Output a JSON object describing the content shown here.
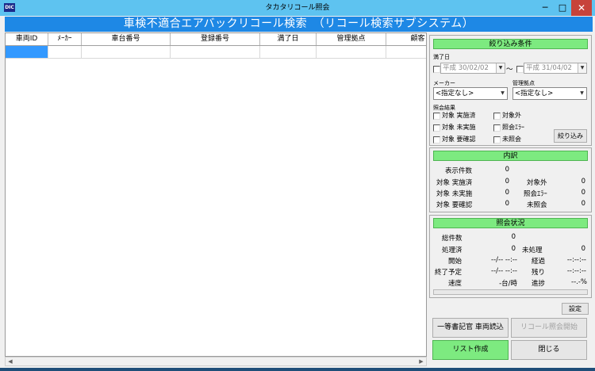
{
  "window": {
    "title": "タカタリコール照会",
    "icon_text": "DIC",
    "minimize": "─",
    "maximize": "□",
    "close": "✕"
  },
  "banner": {
    "title": "車検不適合エアバックリコール検索　（リコール検索サブシステム）"
  },
  "grid": {
    "columns": [
      "車両ID",
      "ﾒｰｶｰ",
      "車台番号",
      "登録番号",
      "満了日",
      "管理拠点",
      "顧客"
    ]
  },
  "scroll": {
    "left": "◀",
    "right": "▶"
  },
  "filter": {
    "header": "絞り込み条件",
    "expiry_label": "満了日",
    "date_from": "平成 30/02/02",
    "date_to": "平成 31/04/02",
    "tilde": "～",
    "maker_label": "メーカー",
    "maker_value": "<指定なし>",
    "base_label": "管理拠点",
    "base_value": "<指定なし>",
    "result_label": "照会結果",
    "checks": [
      "対象 実施済",
      "対象外",
      "対象 未実施",
      "照会ｴﾗｰ",
      "対象 要確認",
      "未照会"
    ],
    "filter_button": "絞り込み",
    "arrow": "▼"
  },
  "breakdown": {
    "header": "内訳",
    "display_count_label": "表示件数",
    "display_count": "0",
    "rows": [
      {
        "l1": "対象 実施済",
        "v1": "0",
        "l2": "対象外",
        "v2": "0"
      },
      {
        "l1": "対象 未実施",
        "v1": "0",
        "l2": "照会ｴﾗｰ",
        "v2": "0"
      },
      {
        "l1": "対象 要確認",
        "v1": "0",
        "l2": "未照会",
        "v2": "0"
      }
    ]
  },
  "status": {
    "header": "照会状況",
    "total_label": "総件数",
    "total": "0",
    "processed_label": "処理済",
    "processed": "0",
    "unprocessed_label": "未処理",
    "unprocessed": "0",
    "start_label": "開始",
    "start": "--/-- --:--",
    "elapsed_label": "経過",
    "elapsed": "--:--:--",
    "end_label": "終了予定",
    "end": "--/-- --:--",
    "remaining_label": "残り",
    "remaining": "--:--:--",
    "speed_label": "速度",
    "speed": "-台/時",
    "progress_label": "進捗",
    "progress": "--.-%"
  },
  "actions": {
    "settings": "設定",
    "read_vehicles": "一等書記官 車両読込",
    "start_recall": "リコール照会開始",
    "create_list": "リスト作成",
    "close": "閉じる"
  }
}
